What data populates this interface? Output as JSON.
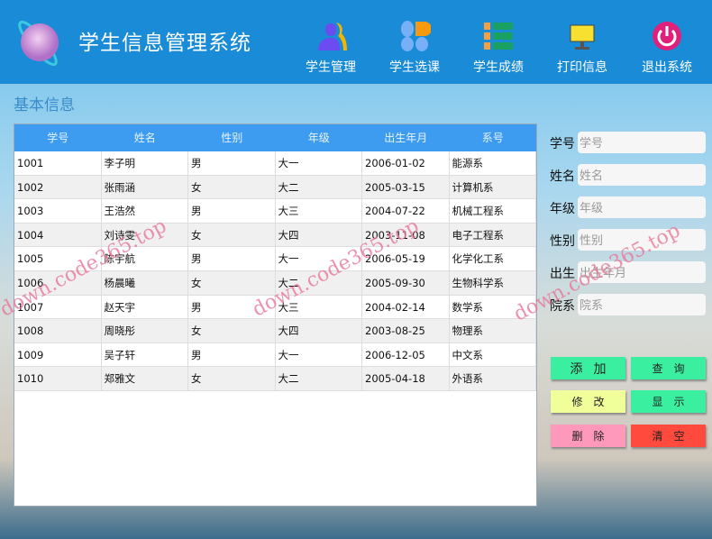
{
  "header": {
    "title": "学生信息管理系统",
    "nav": [
      {
        "label": "学生管理",
        "icon": "users-icon"
      },
      {
        "label": "学生选课",
        "icon": "apps-icon"
      },
      {
        "label": "学生成绩",
        "icon": "list-icon"
      },
      {
        "label": "打印信息",
        "icon": "monitor-icon"
      },
      {
        "label": "退出系统",
        "icon": "power-icon"
      }
    ]
  },
  "section_title": "基本信息",
  "table": {
    "columns": [
      "学号",
      "姓名",
      "性别",
      "年级",
      "出生年月",
      "系号"
    ],
    "rows": [
      [
        "1001",
        "李子明",
        "男",
        "大一",
        "2006-01-02",
        "能源系"
      ],
      [
        "1002",
        "张雨涵",
        "女",
        "大二",
        "2005-03-15",
        "计算机系"
      ],
      [
        "1003",
        "王浩然",
        "男",
        "大三",
        "2004-07-22",
        "机械工程系"
      ],
      [
        "1004",
        "刘诗雯",
        "女",
        "大四",
        "2003-11-08",
        "电子工程系"
      ],
      [
        "1005",
        "陈宇航",
        "男",
        "大一",
        "2006-05-19",
        "化学化工系"
      ],
      [
        "1006",
        "杨晨曦",
        "女",
        "大二",
        "2005-09-30",
        "生物科学系"
      ],
      [
        "1007",
        "赵天宇",
        "男",
        "大三",
        "2004-02-14",
        "数学系"
      ],
      [
        "1008",
        "周晓彤",
        "女",
        "大四",
        "2003-08-25",
        "物理系"
      ],
      [
        "1009",
        "吴子轩",
        "男",
        "大一",
        "2006-12-05",
        "中文系"
      ],
      [
        "1010",
        "郑雅文",
        "女",
        "大二",
        "2005-04-18",
        "外语系"
      ]
    ]
  },
  "form": [
    {
      "label": "学号",
      "placeholder": "学号",
      "value": ""
    },
    {
      "label": "姓名",
      "placeholder": "姓名",
      "value": ""
    },
    {
      "label": "年级",
      "placeholder": "年级",
      "value": ""
    },
    {
      "label": "性别",
      "placeholder": "性别",
      "value": ""
    },
    {
      "label": "出生",
      "placeholder": "出生年月",
      "value": ""
    },
    {
      "label": "院系",
      "placeholder": "院系",
      "value": ""
    }
  ],
  "buttons": {
    "add": "添加",
    "query": "查询",
    "edit": "修改",
    "show": "显示",
    "delete": "删除",
    "clear": "清空"
  },
  "colors": {
    "header": "#1a8bd6",
    "table_header": "#3d9cf0",
    "add": "#3af0a0",
    "edit": "#f0ff99",
    "delete": "#ff99bb",
    "clear": "#ff4a3d"
  },
  "watermark": "down.code365.top"
}
